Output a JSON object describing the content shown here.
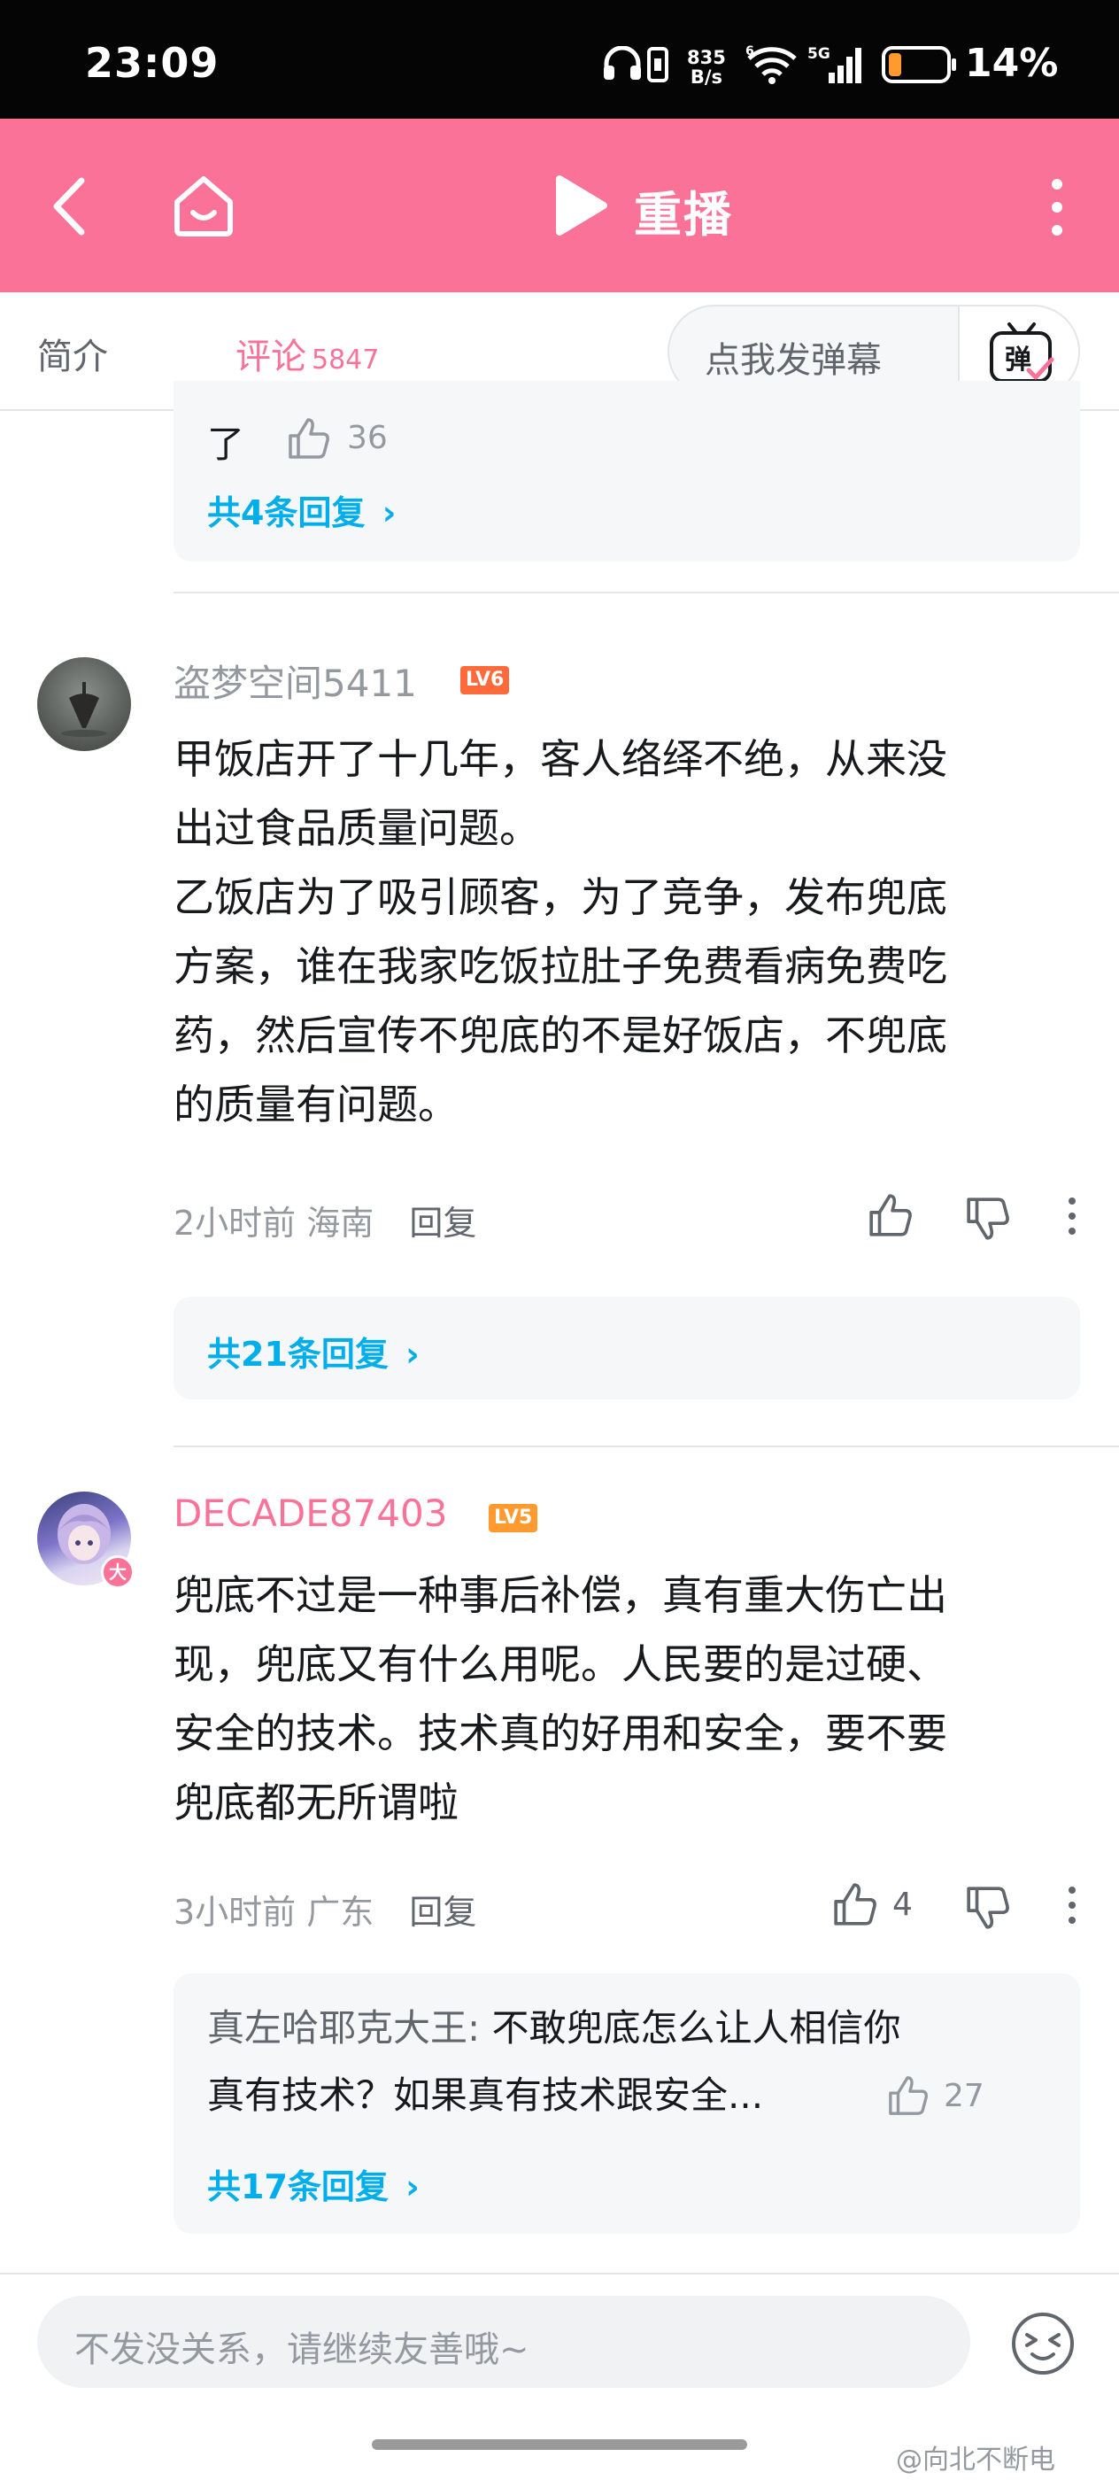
{
  "status_bar": {
    "time": "23:09",
    "net_speed_value": "835",
    "net_speed_unit": "B/s",
    "battery": "14%",
    "icons": [
      "headphones-icon",
      "vibrate-icon",
      "wifi-icon",
      "signal-5g-icon",
      "battery-icon"
    ]
  },
  "top_bar": {
    "title": "重播",
    "icons": [
      "back-icon",
      "home-icon",
      "play-icon",
      "more-vertical-icon"
    ],
    "accent_color": "#fb7299"
  },
  "tabs": {
    "intro": "简介",
    "comments": "评论",
    "comments_count": "5847",
    "danmaku_placeholder": "点我发弹幕",
    "danmaku_icon_text": "弹"
  },
  "partial_comment": {
    "tail_text": "了",
    "like_count": "36",
    "more_replies": "共4条回复"
  },
  "comments": [
    {
      "username": "盗梦空间5411",
      "level": "LV6",
      "level_color": "#ff6a3a",
      "lines": [
        "甲饭店开了十几年，客人络绎不绝，从来没",
        "出过食品质量问题。",
        "乙饭店为了吸引顾客，为了竞争，发布兜底",
        "方案，谁在我家吃饭拉肚子免费看病免费吃",
        "药，然后宣传不兜底的不是好饭店，不兜底",
        "的质量有问题。"
      ],
      "time": "2小时前",
      "location": "海南",
      "reply_label": "回复",
      "like_count": "",
      "more_replies": "共21条回复"
    },
    {
      "username": "DECADE87403",
      "level": "LV5",
      "level_color": "#ff9a2e",
      "avatar_badge": "大",
      "lines": [
        "兜底不过是一种事后补偿，真有重大伤亡出",
        "现，兜底又有什么用呢。人民要的是过硬、",
        "安全的技术。技术真的好用和安全，要不要",
        "兜底都无所谓啦"
      ],
      "time": "3小时前",
      "location": "广东",
      "reply_label": "回复",
      "like_count": "4",
      "sub_reply": {
        "name": "真左哈耶克大王:",
        "line1": " 不敢兜底怎么让人相信你",
        "line2": "真有技术？如果真有技术跟安全...",
        "like_count": "27"
      },
      "more_replies": "共17条回复"
    }
  ],
  "bottom_bar": {
    "input_placeholder": "不发没关系，请继续友善哦~",
    "emoji_icon": "emoji-icon"
  },
  "watermark": "@向北不断电"
}
